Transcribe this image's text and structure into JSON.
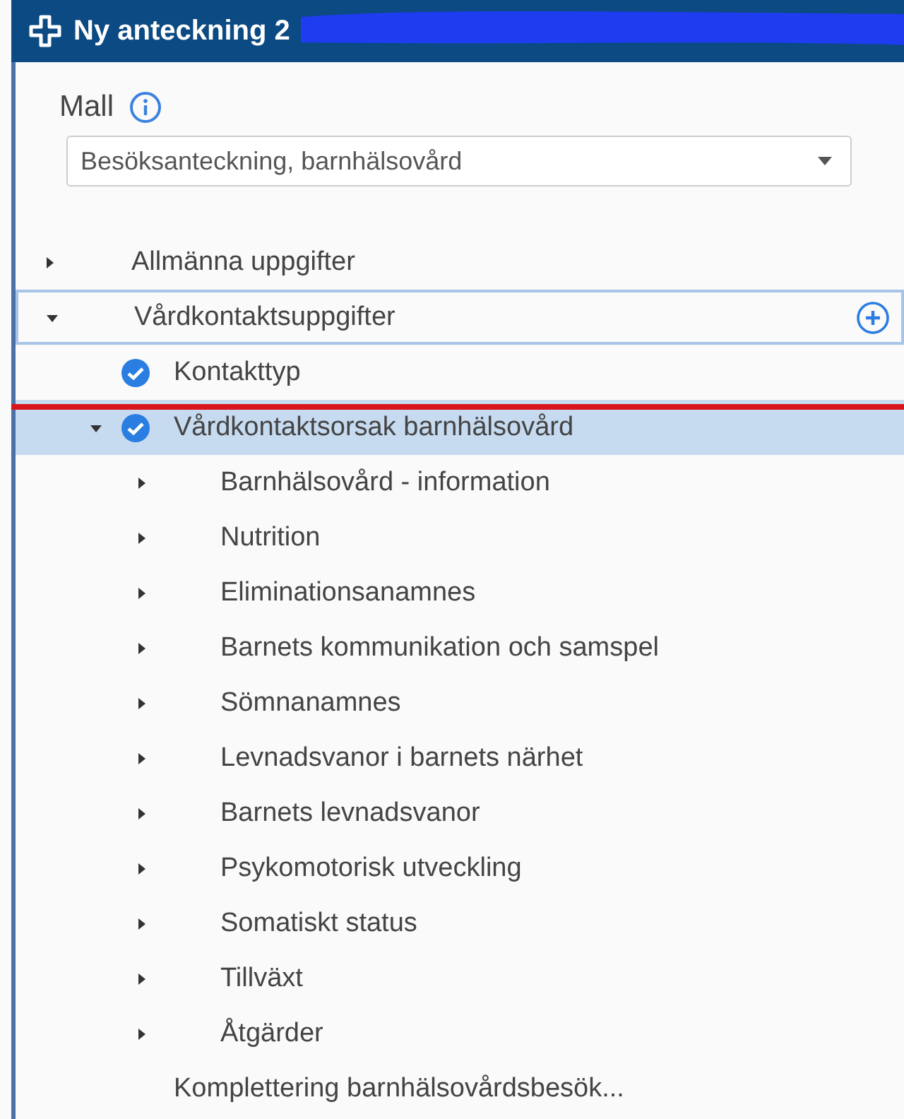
{
  "window": {
    "title": "Ny anteckning 2"
  },
  "template": {
    "label": "Mall",
    "value": "Besöksanteckning, barnhälsovård"
  },
  "tree": [
    {
      "label": "Allmänna uppgifter",
      "kind": "section",
      "expanded": false,
      "focused": false,
      "selected": false
    },
    {
      "label": "Vårdkontaktsuppgifter",
      "kind": "section",
      "expanded": true,
      "focused": true,
      "selected": false,
      "children": [
        {
          "label": "Kontakttyp",
          "kind": "task",
          "checked": true,
          "focused": false,
          "selected": false
        },
        {
          "label": "Vårdkontaktsorsak barnhälsovård",
          "kind": "task",
          "checked": true,
          "expanded": true,
          "focused": false,
          "selected": true,
          "children": [
            {
              "label": "Barnhälsovård - information",
              "kind": "section",
              "expanded": false,
              "focused": false,
              "selected": false
            },
            {
              "label": "Nutrition",
              "kind": "section",
              "expanded": false,
              "focused": false,
              "selected": false
            },
            {
              "label": "Eliminationsanamnes",
              "kind": "section",
              "expanded": false,
              "focused": false,
              "selected": false
            },
            {
              "label": "Barnets kommunikation och samspel",
              "kind": "section",
              "expanded": false,
              "focused": false,
              "selected": false
            },
            {
              "label": "Sömnanamnes",
              "kind": "section",
              "expanded": false,
              "focused": false,
              "selected": false
            },
            {
              "label": "Levnadsvanor i barnets närhet",
              "kind": "section",
              "expanded": false,
              "focused": false,
              "selected": false
            },
            {
              "label": "Barnets levnadsvanor",
              "kind": "section",
              "expanded": false,
              "focused": false,
              "selected": false
            },
            {
              "label": "Psykomotorisk utveckling",
              "kind": "section",
              "expanded": false,
              "focused": false,
              "selected": false
            },
            {
              "label": "Somatiskt status",
              "kind": "section",
              "expanded": false,
              "focused": false,
              "selected": false
            },
            {
              "label": "Tillväxt",
              "kind": "section",
              "expanded": false,
              "focused": false,
              "selected": false
            },
            {
              "label": "Åtgärder",
              "kind": "section",
              "expanded": false,
              "focused": false,
              "selected": false
            }
          ]
        },
        {
          "label": "Komplettering barnhälsovårdsbesök...",
          "kind": "plain",
          "focused": false,
          "selected": false
        }
      ]
    }
  ]
}
